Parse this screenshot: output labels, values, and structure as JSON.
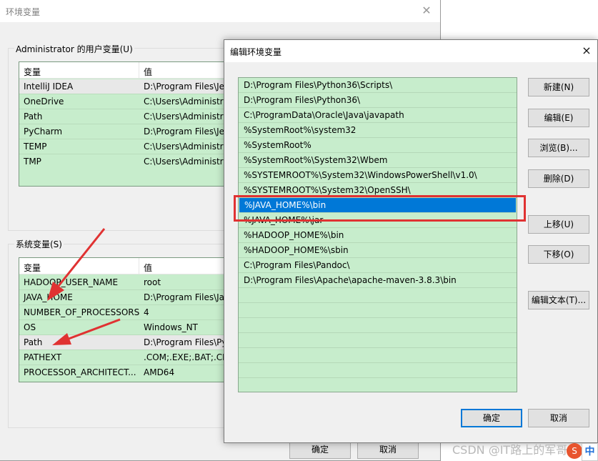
{
  "bg_dialog": {
    "title": "环境变量",
    "user_group": {
      "label": "Administrator 的用户变量(U)",
      "col_var": "变量",
      "col_val": "值",
      "rows": [
        {
          "name": "IntelliJ IDEA",
          "value": "D:\\Program Files\\Je"
        },
        {
          "name": "OneDrive",
          "value": "C:\\Users\\Administra"
        },
        {
          "name": "Path",
          "value": "C:\\Users\\Administra"
        },
        {
          "name": "PyCharm",
          "value": "D:\\Program Files\\Je"
        },
        {
          "name": "TEMP",
          "value": "C:\\Users\\Administra"
        },
        {
          "name": "TMP",
          "value": "C:\\Users\\Administra"
        }
      ]
    },
    "system_group": {
      "label": "系统变量(S)",
      "col_var": "变量",
      "col_val": "值",
      "rows": [
        {
          "name": "HADOOP_USER_NAME",
          "value": "root"
        },
        {
          "name": "JAVA_HOME",
          "value": "D:\\Program Files\\Ja"
        },
        {
          "name": "NUMBER_OF_PROCESSORS",
          "value": "4"
        },
        {
          "name": "OS",
          "value": "Windows_NT"
        },
        {
          "name": "Path",
          "value": "D:\\Program Files\\Py"
        },
        {
          "name": "PATHEXT",
          "value": ".COM;.EXE;.BAT;.CM"
        },
        {
          "name": "PROCESSOR_ARCHITECT...",
          "value": "AMD64"
        }
      ]
    },
    "ok_label": "确定",
    "cancel_label": "取消"
  },
  "edit_dialog": {
    "title": "编辑环境变量",
    "close_glyph": "×",
    "items": [
      "D:\\Program Files\\Python36\\Scripts\\",
      "D:\\Program Files\\Python36\\",
      "C:\\ProgramData\\Oracle\\Java\\javapath",
      "%SystemRoot%\\system32",
      "%SystemRoot%",
      "%SystemRoot%\\System32\\Wbem",
      "%SYSTEMROOT%\\System32\\WindowsPowerShell\\v1.0\\",
      "%SYSTEMROOT%\\System32\\OpenSSH\\",
      "%JAVA_HOME%\\bin",
      "%JAVA_HOME%\\jar",
      "%HADOOP_HOME%\\bin",
      "%HADOOP_HOME%\\sbin",
      "C:\\Program Files\\Pandoc\\",
      "D:\\Program Files\\Apache\\apache-maven-3.8.3\\bin"
    ],
    "selected_item": "%JAVA_HOME%\\bin",
    "buttons": {
      "new": "新建(N)",
      "edit": "编辑(E)",
      "browse": "浏览(B)...",
      "delete": "删除(D)",
      "move_up": "上移(U)",
      "move_down": "下移(O)",
      "edit_text": "编辑文本(T)...",
      "ok": "确定",
      "cancel": "取消"
    }
  },
  "watermark": "CSDN @IT路上的军哥",
  "ime_indicator": "中",
  "colors": {
    "list_bg": "#c7edcc",
    "selection": "#0078d7",
    "annotation_red": "#e03232"
  }
}
